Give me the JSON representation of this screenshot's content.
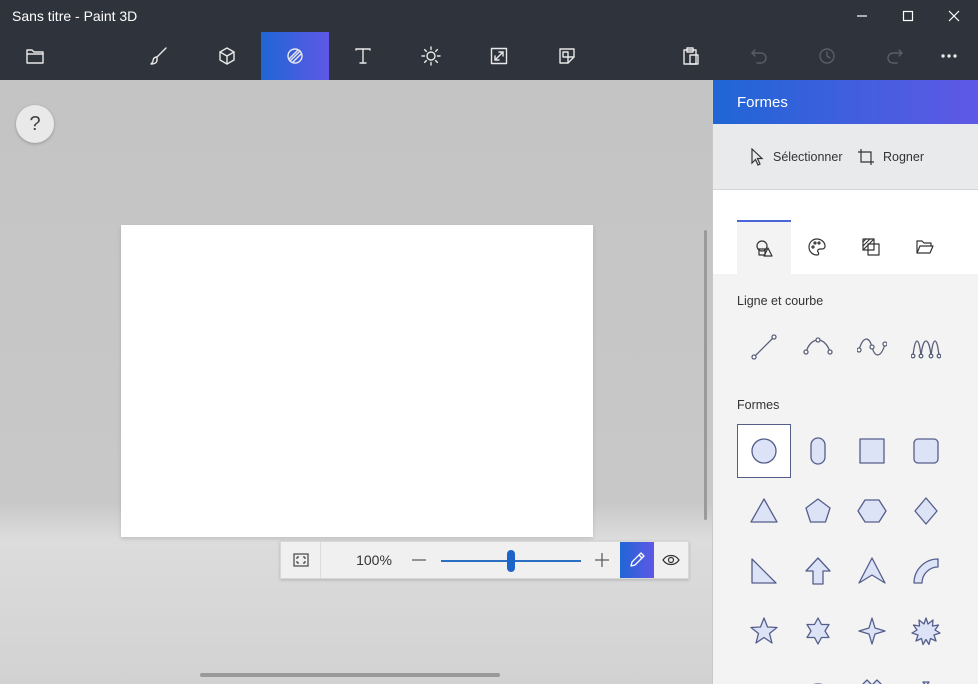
{
  "window": {
    "title": "Sans titre - Paint 3D"
  },
  "toolbar": {
    "items": [
      {
        "name": "menu",
        "icon": "folder-icon"
      },
      {
        "name": "brushes",
        "icon": "brush-icon"
      },
      {
        "name": "3d-shapes",
        "icon": "cube-icon"
      },
      {
        "name": "2d-shapes",
        "icon": "shapes-icon",
        "active": true
      },
      {
        "name": "text",
        "icon": "text-icon"
      },
      {
        "name": "effects",
        "icon": "sun-icon"
      },
      {
        "name": "canvas",
        "icon": "resize-icon"
      },
      {
        "name": "stickers",
        "icon": "sticker-icon"
      },
      {
        "name": "paste",
        "icon": "clipboard-icon"
      },
      {
        "name": "undo",
        "icon": "undo-icon",
        "disabled": true
      },
      {
        "name": "history",
        "icon": "history-icon",
        "disabled": true
      },
      {
        "name": "redo",
        "icon": "redo-icon",
        "disabled": true
      },
      {
        "name": "more",
        "icon": "more-icon"
      }
    ]
  },
  "workspace": {
    "help_label": "?"
  },
  "zoom": {
    "value": "100%",
    "level_fraction": 0.5,
    "accent": "#1e64c8"
  },
  "panel": {
    "title": "Formes",
    "select_label": "Sélectionner",
    "crop_label": "Rogner",
    "tabs": [
      "shapes-tab",
      "color-tab",
      "texture-tab",
      "folder-tab"
    ],
    "line_section": "Ligne et courbe",
    "shapes_section": "Formes",
    "accent_from": "#1f66d6",
    "accent_to": "#5f58e6"
  }
}
